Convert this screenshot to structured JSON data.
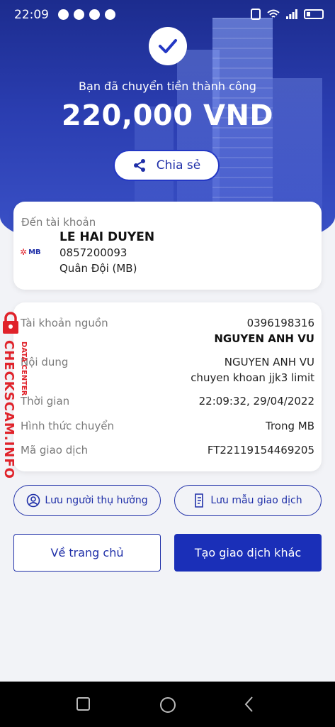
{
  "status_bar": {
    "time": "22:09"
  },
  "hero": {
    "subtitle": "Bạn đã chuyển tiền thành công",
    "amount": "220,000 VND",
    "share_label": "Chia sẻ"
  },
  "recipient": {
    "label": "Đến tài khoản",
    "bank_logo_text": "MB",
    "name": "LE HAI DUYEN",
    "account": "0857200093",
    "bank": "Quân Đội (MB)"
  },
  "details": {
    "source_label": "Tài khoản nguồn",
    "source_account": "0396198316",
    "source_name": "NGUYEN ANH VU",
    "content_label": "Nội dung",
    "content_line1": "NGUYEN ANH VU",
    "content_line2": "chuyen khoan jjk3 limit",
    "time_label": "Thời gian",
    "time_value": "22:09:32, 29/04/2022",
    "method_label": "Hình thức chuyển",
    "method_value": "Trong MB",
    "txn_label": "Mã giao dịch",
    "txn_value": "FT22119154469205"
  },
  "watermark": {
    "main": "CHECKSCAM.INFO",
    "sub": "DATA CENTER"
  },
  "actions": {
    "save_beneficiary": "Lưu người thụ hưởng",
    "save_template": "Lưu mẫu giao dịch",
    "home": "Về trang chủ",
    "new_transaction": "Tạo giao dịch khác"
  },
  "colors": {
    "primary": "#1a2fb8",
    "hero_top": "#1c2c8e",
    "watermark": "#e0222a"
  }
}
